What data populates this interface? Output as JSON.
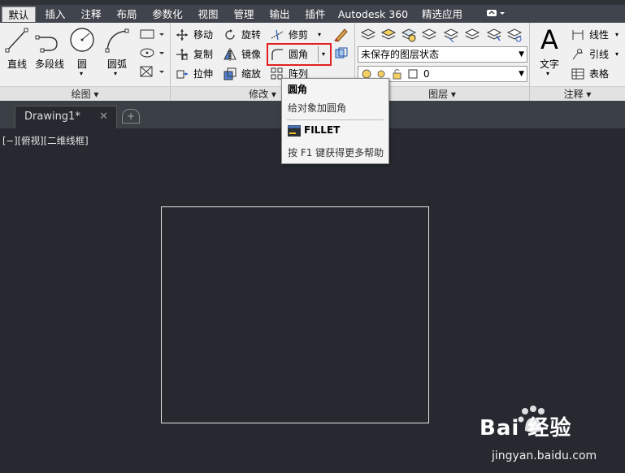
{
  "ribbon_tabs": [
    "默认",
    "插入",
    "注释",
    "布局",
    "参数化",
    "视图",
    "管理",
    "输出",
    "插件",
    "Autodesk 360",
    "精选应用"
  ],
  "draw_panel": {
    "title": "绘图 ▾",
    "line": "直线",
    "polyline": "多段线",
    "circle": "圆",
    "arc": "圆弧"
  },
  "modify_panel": {
    "title": "修改 ▾",
    "move": "移动",
    "rotate": "旋转",
    "trim": "修剪",
    "copy": "复制",
    "mirror": "镜像",
    "fillet": "圆角",
    "stretch": "拉伸",
    "scale": "缩放",
    "array": "阵列"
  },
  "layer_panel": {
    "title": "图层 ▾",
    "layer_state": "未保存的图层状态",
    "current_layer": "0"
  },
  "annotation_panel": {
    "title": "注释 ▾",
    "text": "文字",
    "linear": "线性",
    "leader": "引线",
    "table": "表格"
  },
  "file_tab": {
    "name": "Drawing1*",
    "close": "✕"
  },
  "viewport_label": "[−][俯视][二维线框]",
  "tooltip": {
    "title": "圆角",
    "description": "给对象加圆角",
    "command": "FILLET",
    "help": "按 F1 键获得更多帮助"
  },
  "watermark": {
    "brand": "Bai 经验",
    "url": "jingyan.baidu.com"
  },
  "colors": {
    "canvas": "#26292f",
    "tab_bar": "#40444c",
    "ribbon": "#f0f0f0",
    "highlight": "#e02020"
  }
}
